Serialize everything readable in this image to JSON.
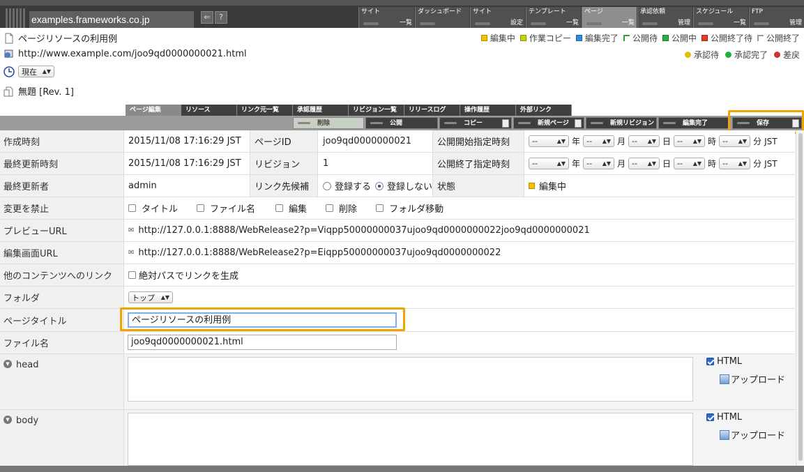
{
  "topbar": {
    "site_name": "examples.frameworks.co.jp",
    "nav": [
      {
        "top": "サイト",
        "bottom": "一覧"
      },
      {
        "top": "ダッシュボード",
        "bottom": ""
      },
      {
        "top": "サイト",
        "bottom": "設定"
      },
      {
        "top": "テンプレート",
        "bottom": "一覧"
      },
      {
        "top": "ページ",
        "bottom": "一覧"
      },
      {
        "top": "承認依頼",
        "bottom": "管理"
      },
      {
        "top": "スケジュール",
        "bottom": "一覧"
      },
      {
        "top": "FTP",
        "bottom": "管理"
      }
    ],
    "help": "?"
  },
  "header": {
    "page_title": "ページリソースの利用例",
    "url": "http://www.example.com/joo9qd0000000021.html",
    "time_select": "現在",
    "revision": "無題 [Rev. 1]"
  },
  "legend": {
    "status": [
      {
        "label": "編集中",
        "color": "#f2c200"
      },
      {
        "label": "作業コピー",
        "color": "#c8d400"
      },
      {
        "label": "編集完了",
        "color": "#2d8fe0"
      },
      {
        "label": "公開待",
        "color": "#30a030"
      },
      {
        "label": "公開中",
        "color": "#28b040"
      },
      {
        "label": "公開終了待",
        "color": "#e04020"
      },
      {
        "label": "公開終了",
        "color": "#dddddd"
      }
    ],
    "approval": [
      {
        "label": "承認待",
        "color": "#e0c000"
      },
      {
        "label": "承認完了",
        "color": "#20b040"
      },
      {
        "label": "差戻",
        "color": "#d03030"
      }
    ]
  },
  "tabs": [
    "ページ編集",
    "リソース",
    "リンク元一覧",
    "承認履歴",
    "リビジョン一覧",
    "リリースログ",
    "操作履歴",
    "外部リンク"
  ],
  "toolbar": {
    "delete": "削除",
    "publish": "公開",
    "copy": "コピー",
    "new_page": "新規ページ",
    "new_revision": "新規リビジョン",
    "edit_done": "編集完了",
    "save": "保存"
  },
  "form": {
    "created_label": "作成時刻",
    "created_value": "2015/11/08 17:16:29 JST",
    "page_id_label": "ページID",
    "page_id_value": "joo9qd0000000021",
    "pub_start_label": "公開開始指定時刻",
    "updated_label": "最終更新時刻",
    "updated_value": "2015/11/08 17:16:29 JST",
    "revision_label": "リビジョン",
    "revision_value": "1",
    "pub_end_label": "公開終了指定時刻",
    "updater_label": "最終更新者",
    "updater_value": "admin",
    "link_candidate_label": "リンク先候補",
    "link_register": "登録する",
    "link_no_register": "登録しない",
    "state_label": "状態",
    "state_value": "編集中",
    "date_placeholder": "--",
    "unit_year": "年",
    "unit_month": "月",
    "unit_day": "日",
    "unit_hour": "時",
    "unit_minute": "分",
    "tz": "JST",
    "lock_label": "変更を禁止",
    "lock_opts": [
      "タイトル",
      "ファイル名",
      "編集",
      "削除",
      "フォルダ移動"
    ],
    "preview_url_label": "プレビューURL",
    "preview_url": "http://127.0.0.1:8888/WebRelease2?p=Viqpp50000000037ujoo9qd0000000022joo9qd0000000021",
    "edit_url_label": "編集画面URL",
    "edit_url": "http://127.0.0.1:8888/WebRelease2?p=Eiqpp50000000037ujoo9qd0000000022",
    "link_other_label": "他のコンテンツへのリンク",
    "absolute_path": "絶対パスでリンクを生成",
    "folder_label": "フォルダ",
    "folder_value": "トップ",
    "title_label": "ページタイトル",
    "title_value": "ページリソースの利用例",
    "filename_label": "ファイル名",
    "filename_value": "joo9qd0000000021.html",
    "head_label": "head",
    "body_label": "body",
    "html_label": "HTML",
    "upload_label": "アップロード"
  }
}
